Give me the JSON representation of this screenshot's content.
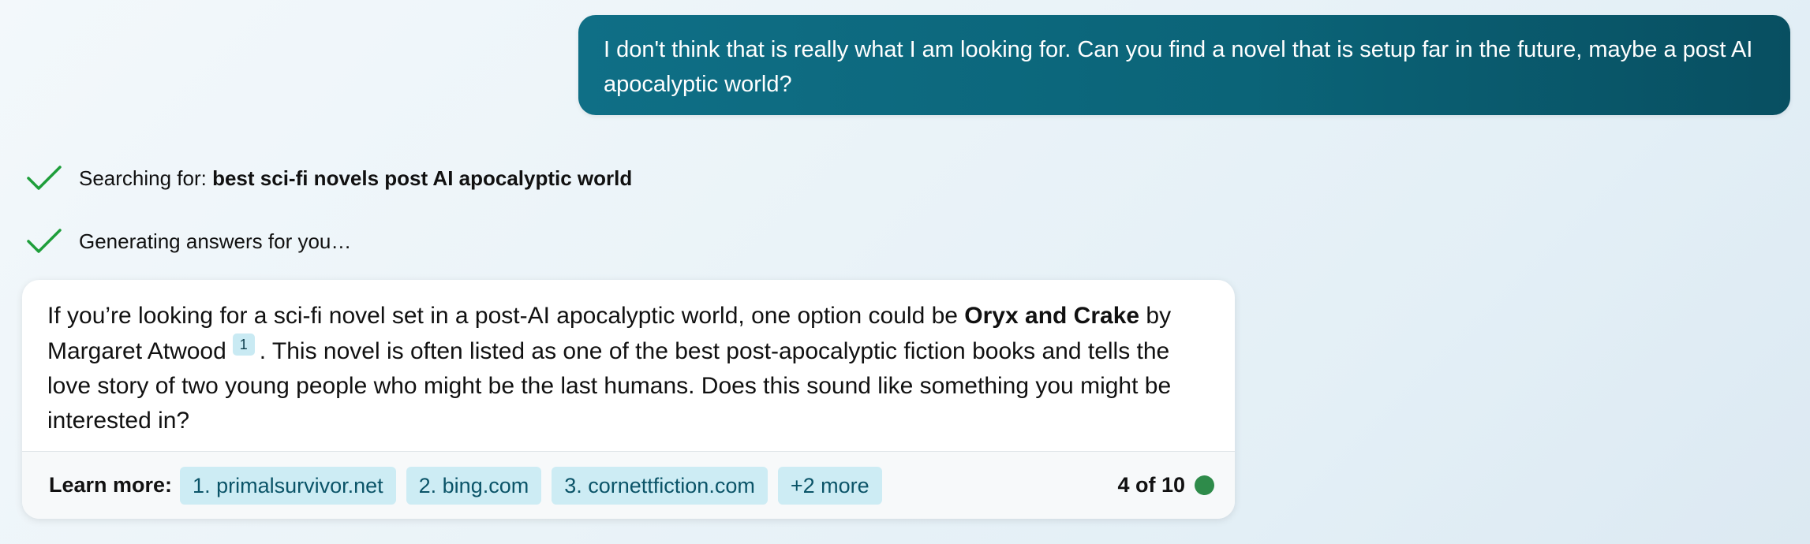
{
  "user_message": {
    "text": "I don't think that is really what I am looking for. Can you find a novel that is setup far in the future, maybe a post AI apocalyptic world?"
  },
  "status": {
    "searching_prefix": "Searching for: ",
    "searching_query": "best sci-fi novels post AI apocalyptic world",
    "generating": "Generating answers for you…",
    "icon": "checkmark-icon",
    "check_color": "#1e9e3a"
  },
  "answer": {
    "part1": "If you’re looking for a sci-fi novel set in a post-AI apocalyptic world, one option could be ",
    "bold_title": "Oryx and Crake",
    "part2": " by Margaret Atwood",
    "citation": "1",
    "part3": ". This novel is often listed as one of the best post-apocalyptic fiction books and tells the love story of two young people who might be the last humans. Does this sound like something you might be interested in?"
  },
  "learn_more": {
    "label": "Learn more:",
    "sources": [
      "1. primalsurvivor.net",
      "2. bing.com",
      "3. cornettfiction.com"
    ],
    "more": "+2 more"
  },
  "turn_counter": {
    "text": "4 of 10",
    "dot_color": "#2e8b4a"
  },
  "colors": {
    "user_bubble": "#0b6478",
    "chip_bg": "#cdecf4",
    "chip_text": "#0b5468"
  }
}
